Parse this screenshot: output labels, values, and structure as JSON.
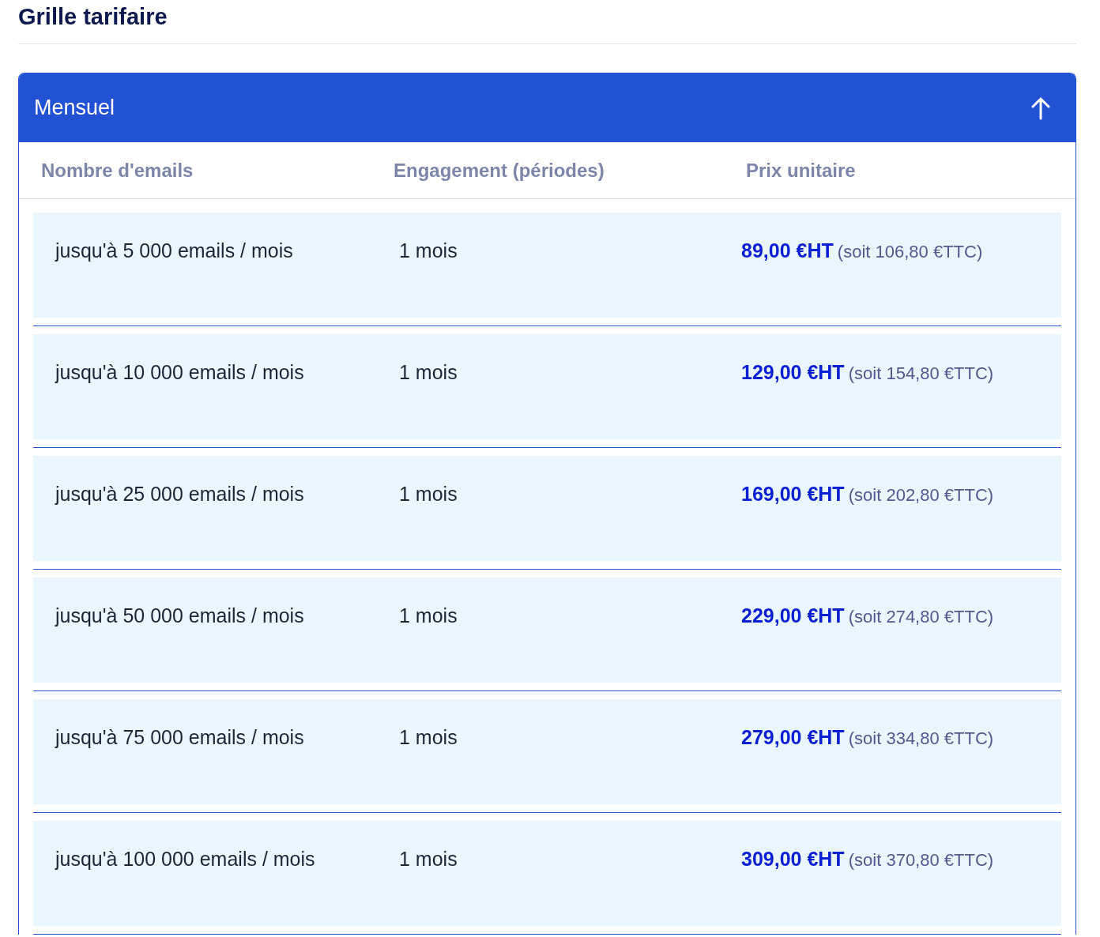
{
  "title": "Grille tarifaire",
  "panel": {
    "title": "Mensuel",
    "expanded": true
  },
  "table": {
    "columns": [
      "Nombre d'emails",
      "Engagement (périodes)",
      "Prix unitaire"
    ],
    "rows": [
      {
        "emails": "jusqu'à 5 000 emails / mois",
        "engagement": "1 mois",
        "price": "89,00 €HT",
        "price_ttc": "(soit 106,80 €TTC)"
      },
      {
        "emails": "jusqu'à 10 000 emails / mois",
        "engagement": "1 mois",
        "price": "129,00 €HT",
        "price_ttc": "(soit 154,80 €TTC)"
      },
      {
        "emails": "jusqu'à 25 000 emails / mois",
        "engagement": "1 mois",
        "price": "169,00 €HT",
        "price_ttc": "(soit 202,80 €TTC)"
      },
      {
        "emails": "jusqu'à 50 000 emails / mois",
        "engagement": "1 mois",
        "price": "229,00 €HT",
        "price_ttc": "(soit 274,80 €TTC)"
      },
      {
        "emails": "jusqu'à 75 000 emails / mois",
        "engagement": "1 mois",
        "price": "279,00 €HT",
        "price_ttc": "(soit 334,80 €TTC)"
      },
      {
        "emails": "jusqu'à 100 000 emails / mois",
        "engagement": "1 mois",
        "price": "309,00 €HT",
        "price_ttc": "(soit 370,80 €TTC)"
      }
    ]
  }
}
